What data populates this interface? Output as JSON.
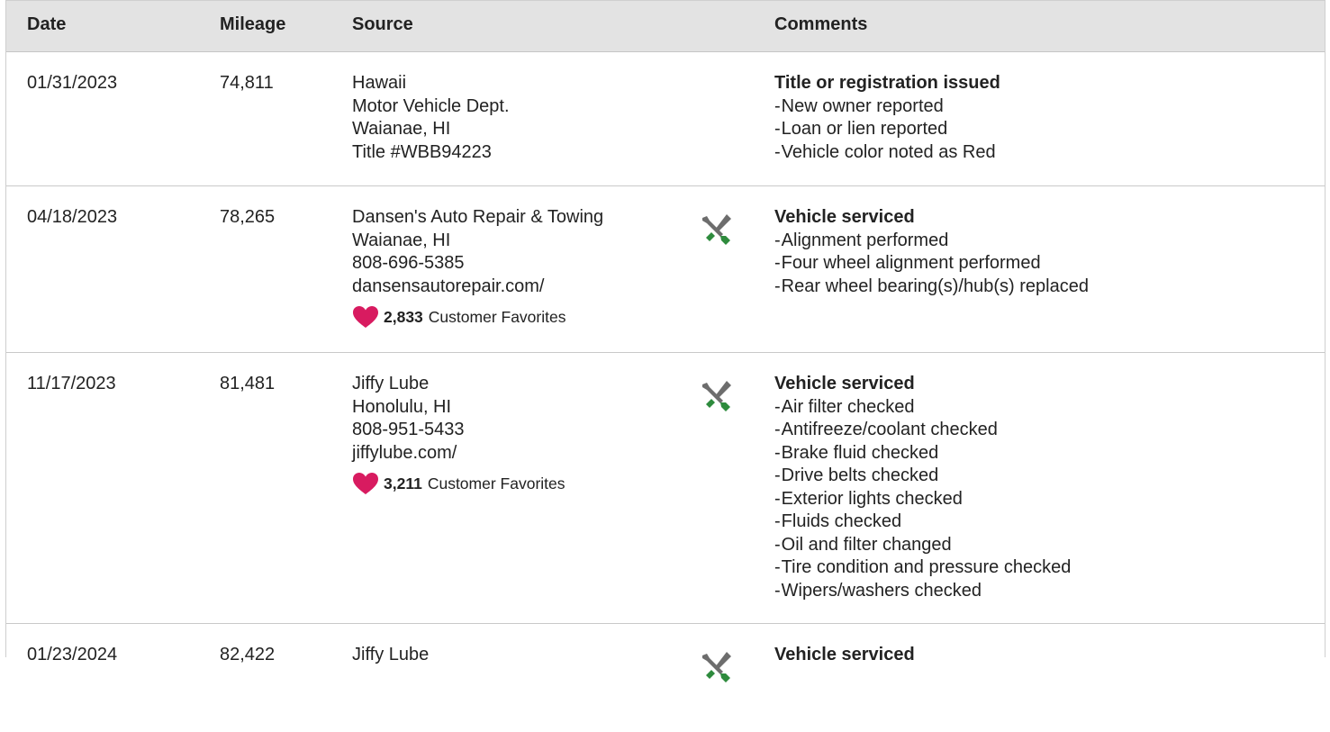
{
  "columns": {
    "date": "Date",
    "mileage": "Mileage",
    "source": "Source",
    "comments": "Comments"
  },
  "favorites_label": "Customer Favorites",
  "colors": {
    "header_bg": "#e3e3e3",
    "heart": "#d81b60",
    "wrench_green": "#2e8b3d",
    "tool_gray": "#6d6d6d"
  },
  "records": [
    {
      "date": "01/31/2023",
      "mileage": "74,811",
      "source": [
        "Hawaii",
        "Motor Vehicle Dept.",
        "Waianae, HI",
        "Title #WBB94223"
      ],
      "icon": "",
      "favorites": "",
      "comment_title": "Title or registration issued",
      "comment_items": [
        "New owner reported",
        "Loan or lien reported",
        "Vehicle color noted as Red"
      ]
    },
    {
      "date": "04/18/2023",
      "mileage": "78,265",
      "source": [
        "Dansen's Auto Repair & Towing",
        "Waianae, HI",
        "808-696-5385",
        "dansensautorepair.com/"
      ],
      "icon": "service-tools-icon",
      "favorites": "2,833",
      "comment_title": "Vehicle serviced",
      "comment_items": [
        "Alignment performed",
        "Four wheel alignment performed",
        "Rear wheel bearing(s)/hub(s) replaced"
      ]
    },
    {
      "date": "11/17/2023",
      "mileage": "81,481",
      "source": [
        "Jiffy Lube",
        "Honolulu, HI",
        "808-951-5433",
        "jiffylube.com/"
      ],
      "icon": "service-tools-icon",
      "favorites": "3,211",
      "comment_title": "Vehicle serviced",
      "comment_items": [
        "Air filter checked",
        "Antifreeze/coolant checked",
        "Brake fluid checked",
        "Drive belts checked",
        "Exterior lights checked",
        "Fluids checked",
        "Oil and filter changed",
        "Tire condition and pressure checked",
        "Wipers/washers checked"
      ]
    },
    {
      "date": "01/23/2024",
      "mileage": "82,422",
      "source": [
        "Jiffy Lube"
      ],
      "icon": "service-tools-icon",
      "favorites": "",
      "comment_title": "Vehicle serviced",
      "comment_items": []
    }
  ]
}
